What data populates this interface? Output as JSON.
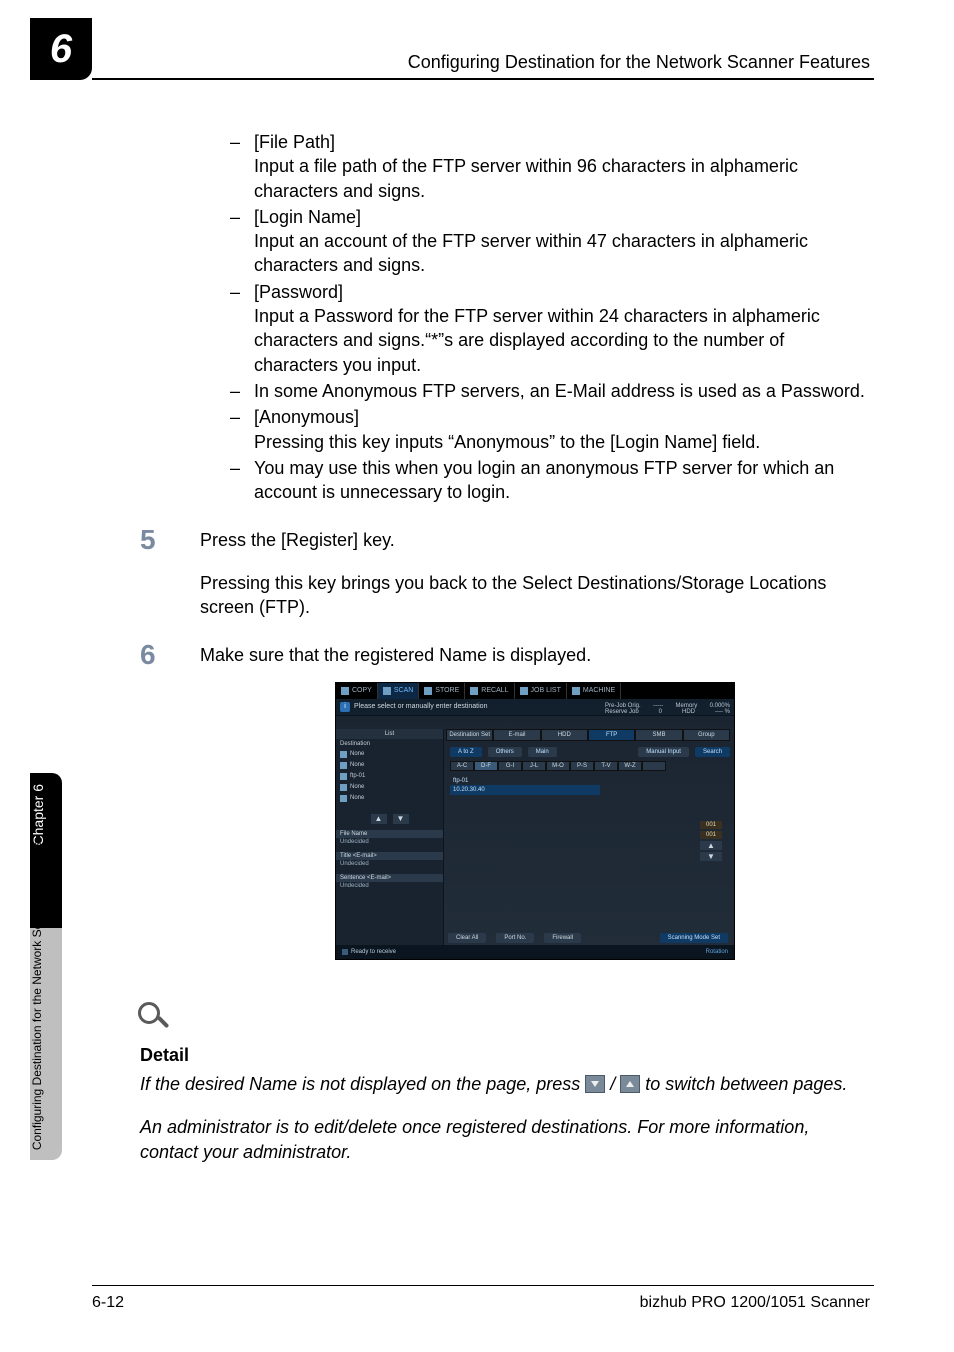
{
  "chapter_number": "6",
  "running_head": "Configuring Destination for the Network Scanner Features",
  "bullets": [
    {
      "title": "[File Path]",
      "desc": "Input a file path of the FTP server within 96 characters in alphameric characters and signs."
    },
    {
      "title": "[Login Name]",
      "desc": "Input an account of the FTP server within 47 characters in alphameric characters and signs."
    },
    {
      "title": "[Password]",
      "desc": "Input a Password for the FTP server within 24 characters in alphameric characters and signs.“*”s are displayed according to the number of characters you input."
    },
    {
      "title": "",
      "desc": "In some Anonymous FTP servers, an E-Mail address is used as a Password."
    },
    {
      "title": "[Anonymous]",
      "desc": "Pressing this key inputs “Anonymous” to the [Login Name] field."
    },
    {
      "title": "",
      "desc": "You may use this when you login an anonymous FTP server for which an account is unnecessary to login."
    }
  ],
  "steps": {
    "five": {
      "num": "5",
      "line1": "Press the [Register] key.",
      "line2": "Pressing this key brings you back to the Select Destinations/Storage Locations screen (FTP)."
    },
    "six": {
      "num": "6",
      "line1": "Make sure that the registered Name is displayed."
    }
  },
  "screenshot": {
    "tabs": [
      "COPY",
      "SCAN",
      "STORE",
      "RECALL",
      "JOB LIST",
      "MACHINE"
    ],
    "active_tab_index": 1,
    "message": "Please select or manually enter destination",
    "stats": {
      "row1_left": "Pre-Job Orig.",
      "row1_mid": "-----",
      "row1_rlabel": "Memory",
      "row1_rval": "0.000%",
      "row2_left": "Reserve Job",
      "row2_mid": "0",
      "row2_rlabel": "HDD",
      "row2_rval": "---- %"
    },
    "side_header": "List",
    "side_rows": [
      {
        "label": "Destination",
        "value": ""
      },
      {
        "label": "",
        "value": "None"
      },
      {
        "label": "",
        "value": "None"
      },
      {
        "label": "",
        "value": "ftp-01"
      },
      {
        "label": "",
        "value": "None"
      },
      {
        "label": "",
        "value": "None"
      }
    ],
    "side_sections": [
      {
        "header": "File Name",
        "value": "Undecided"
      },
      {
        "header": "Title <E-mail>",
        "value": "Undecided"
      },
      {
        "header": "Sentence <E-mail>",
        "value": "Undecided"
      }
    ],
    "modes_row": [
      "Destination Set",
      "E-mail",
      "HDD",
      "FTP",
      "SMB",
      "Group"
    ],
    "modes_selected_index": 3,
    "az_buttons": {
      "az": "A to Z",
      "others": "Others",
      "main": "Main",
      "manual": "Manual Input",
      "search": "Search"
    },
    "alpha": [
      "A-C",
      "D-F",
      "G-I",
      "J-L",
      "M-O",
      "P-S",
      "T-V",
      "W-Z",
      ""
    ],
    "alpha_selected_index": 1,
    "entry": {
      "name": "ftp-01",
      "ip": "10.20.30.40"
    },
    "counter": {
      "top": "001",
      "bottom": "001"
    },
    "bottom_buttons": [
      "Clear All",
      "Port No.",
      "Firewall",
      "Scanning Mode Set"
    ],
    "status_left": "Ready to receive",
    "status_right": "Rotation"
  },
  "detail": {
    "heading": "Detail",
    "p1a": "If the desired Name is not displayed on the page, press ",
    "p1b": " / ",
    "p1c": " to switch between pages.",
    "p2": "An administrator is to edit/delete once registered destinations. For more information, contact your administrator."
  },
  "side_labels": {
    "chapter": "Chapter 6",
    "long": "Configuring Destination for the Network Scanner Features"
  },
  "footer": {
    "left": "6-12",
    "right": "bizhub PRO 1200/1051 Scanner"
  }
}
